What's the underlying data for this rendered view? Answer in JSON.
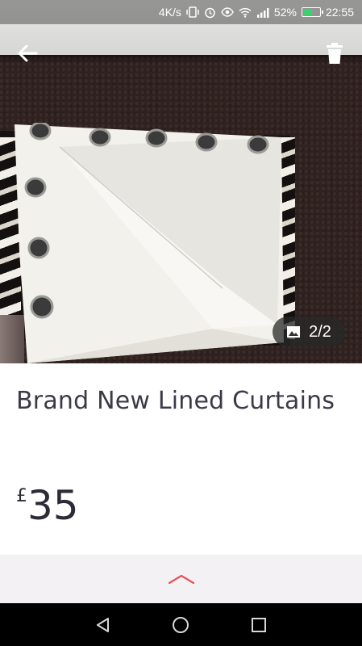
{
  "status_bar": {
    "network_speed": "4K/s",
    "battery_percent": "52%",
    "time": "22:55",
    "icons": [
      "vibrate-icon",
      "alarm-icon",
      "eye-icon",
      "wifi-icon",
      "signal-icon",
      "battery-icon"
    ]
  },
  "listing": {
    "title": "Brand New Lined Curtains",
    "currency": "£",
    "price": "35"
  },
  "gallery": {
    "counter": "2/2"
  },
  "colors": {
    "accent": "#e0555a",
    "title_text": "#3b3b47",
    "expand_bar": "#f4f1f4"
  }
}
